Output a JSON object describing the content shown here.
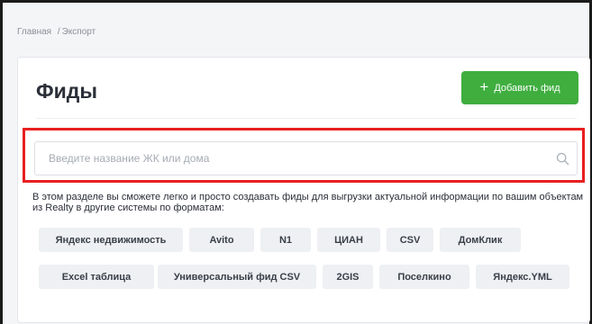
{
  "breadcrumb": {
    "home": "Главная",
    "separator": "/",
    "current": "Экспорт"
  },
  "page": {
    "title": "Фиды"
  },
  "add_button": {
    "icon": "plus-icon",
    "label": "Добавить фид"
  },
  "search": {
    "placeholder": "Введите название ЖК или дома",
    "value": "",
    "icon": "search-icon"
  },
  "description": "В этом разделе вы сможете легко и просто создавать фиды для выгрузки актуальной информации по вашим объектам из Realty в другие системы по форматам:",
  "formats": {
    "yandex_realty": "Яндекс недвижимость",
    "avito": "Avito",
    "n1": "N1",
    "cian": "ЦИАН",
    "csv": "CSV",
    "domclick": "ДомКлик",
    "excel": "Excel таблица",
    "universal_csv": "Универсальный фид CSV",
    "twogis": "2GIS",
    "poselkino": "Поселкино",
    "yandex_yml": "Яндекс.YML"
  },
  "colors": {
    "accent_green": "#3fae3f",
    "highlight_red": "#e81f1f",
    "tag_bg": "#eef0f3"
  }
}
